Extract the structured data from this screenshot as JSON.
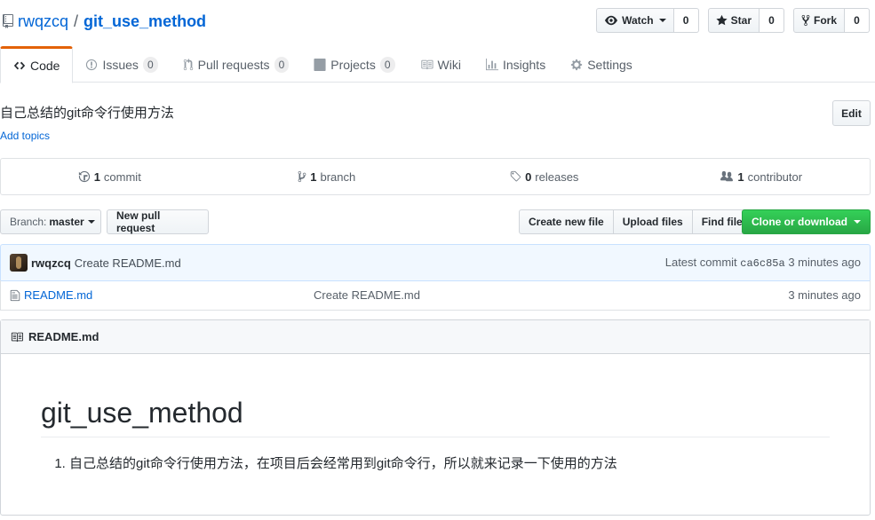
{
  "repo": {
    "owner": "rwqzcq",
    "separator": "/",
    "name": "git_use_method"
  },
  "actions": {
    "watch_label": "Watch",
    "watch_count": "0",
    "star_label": "Star",
    "star_count": "0",
    "fork_label": "Fork",
    "fork_count": "0"
  },
  "nav": {
    "code": "Code",
    "issues": "Issues",
    "issues_count": "0",
    "pulls": "Pull requests",
    "pulls_count": "0",
    "projects": "Projects",
    "projects_count": "0",
    "wiki": "Wiki",
    "insights": "Insights",
    "settings": "Settings"
  },
  "meta": {
    "description": "自己总结的git命令行使用方法",
    "add_topics": "Add topics",
    "edit_label": "Edit"
  },
  "summary": {
    "commits_num": "1",
    "commits_label": "commit",
    "branches_num": "1",
    "branches_label": "branch",
    "releases_num": "0",
    "releases_label": "releases",
    "contributors_num": "1",
    "contributors_label": "contributor"
  },
  "file_nav": {
    "branch_prefix": "Branch:",
    "branch_name": "master",
    "new_pr": "New pull request",
    "create_file": "Create new file",
    "upload_files": "Upload files",
    "find_file": "Find file",
    "clone": "Clone or download"
  },
  "commit": {
    "author": "rwqzcq",
    "message": "Create README.md",
    "latest_label": "Latest commit",
    "sha": "ca6c85a",
    "age": "3 minutes ago"
  },
  "files": [
    {
      "name": "README.md",
      "message": "Create README.md",
      "age": "3 minutes ago"
    }
  ],
  "readme": {
    "header": "README.md",
    "title": "git_use_method",
    "items": [
      "自己总结的git命令行使用方法，在项目后会经常用到git命令行，所以就来记录一下使用的方法"
    ]
  },
  "icons": {
    "repo": "repo-icon",
    "eye": "eye-icon",
    "star": "star-icon",
    "fork": "repo-forked-icon",
    "code": "code-icon",
    "issue": "issue-opened-icon",
    "pr": "git-pull-request-icon",
    "project": "project-icon",
    "book": "book-icon",
    "graph": "graph-icon",
    "gear": "gear-icon",
    "history": "history-icon",
    "branch": "git-branch-icon",
    "tag": "tag-icon",
    "people": "organization-icon",
    "file": "file-text-icon"
  },
  "colors": {
    "link": "#0366d6",
    "accent_tab": "#e36209",
    "clone_green": "#28a745",
    "commit_bg": "#f1f8ff"
  }
}
